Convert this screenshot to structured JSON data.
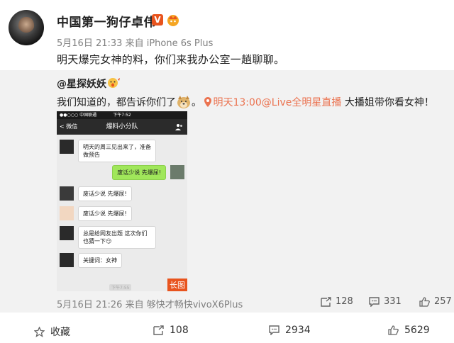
{
  "post": {
    "username": "中国第一狗仔卓伟",
    "verified_badge": "V",
    "time": "5月16日 21:33",
    "source_prefix": "来自",
    "source": "iPhone 6s Plus",
    "text": "明天爆完女神的料，你们来我办公室一趟聊聊。"
  },
  "repost": {
    "author": "@星探妖妖",
    "text_prefix": "我们知道的，都告诉你们了",
    "text_mid": "。",
    "live_link": "明天13:00@Live全明星直播",
    "text_suffix": " 大播姐带你看女神！",
    "image_tag": "长图",
    "time": "5月16日 21:26",
    "source_prefix": "来自",
    "source": "够快才畅快vivoX6Plus",
    "stats": {
      "forward": "128",
      "comment": "331",
      "like": "257"
    },
    "phone": {
      "status_left": "●●○○○ 中国联通 ",
      "status_time": "下午7:52",
      "nav_back": "< 微信",
      "nav_title": "爆料小分队",
      "messages": [
        {
          "side": "left",
          "text": "明天的周三见出来了，准备做预告"
        },
        {
          "side": "right",
          "text": "废话少说 先爆尿!"
        },
        {
          "side": "left",
          "text": "废话少说 先爆尿!"
        },
        {
          "side": "left",
          "text": "废话少说 先爆尿!"
        },
        {
          "side": "left",
          "text": "总是给网友出题 这次你们也猜一下😏"
        },
        {
          "side": "left",
          "text": "关键词：女神"
        }
      ],
      "bottom_time": "下午7:55"
    }
  },
  "actions": {
    "favorite": "收藏",
    "forward": "108",
    "comment": "2934",
    "like": "5629"
  },
  "colors": {
    "link": "#eb7350",
    "badge": "#e8541e",
    "bubble_green": "#a0e75a",
    "repost_bg": "#f2f2f2"
  }
}
